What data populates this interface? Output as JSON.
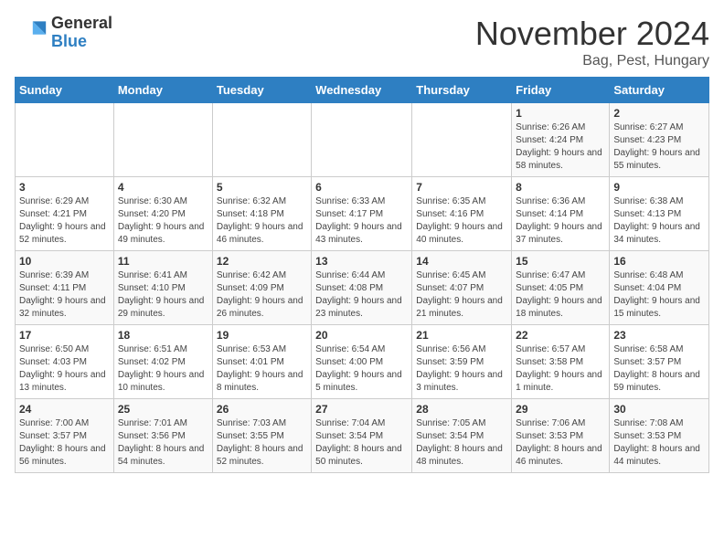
{
  "logo": {
    "general": "General",
    "blue": "Blue"
  },
  "title": "November 2024",
  "subtitle": "Bag, Pest, Hungary",
  "days_header": [
    "Sunday",
    "Monday",
    "Tuesday",
    "Wednesday",
    "Thursday",
    "Friday",
    "Saturday"
  ],
  "weeks": [
    [
      {
        "day": "",
        "info": ""
      },
      {
        "day": "",
        "info": ""
      },
      {
        "day": "",
        "info": ""
      },
      {
        "day": "",
        "info": ""
      },
      {
        "day": "",
        "info": ""
      },
      {
        "day": "1",
        "info": "Sunrise: 6:26 AM\nSunset: 4:24 PM\nDaylight: 9 hours and 58 minutes."
      },
      {
        "day": "2",
        "info": "Sunrise: 6:27 AM\nSunset: 4:23 PM\nDaylight: 9 hours and 55 minutes."
      }
    ],
    [
      {
        "day": "3",
        "info": "Sunrise: 6:29 AM\nSunset: 4:21 PM\nDaylight: 9 hours and 52 minutes."
      },
      {
        "day": "4",
        "info": "Sunrise: 6:30 AM\nSunset: 4:20 PM\nDaylight: 9 hours and 49 minutes."
      },
      {
        "day": "5",
        "info": "Sunrise: 6:32 AM\nSunset: 4:18 PM\nDaylight: 9 hours and 46 minutes."
      },
      {
        "day": "6",
        "info": "Sunrise: 6:33 AM\nSunset: 4:17 PM\nDaylight: 9 hours and 43 minutes."
      },
      {
        "day": "7",
        "info": "Sunrise: 6:35 AM\nSunset: 4:16 PM\nDaylight: 9 hours and 40 minutes."
      },
      {
        "day": "8",
        "info": "Sunrise: 6:36 AM\nSunset: 4:14 PM\nDaylight: 9 hours and 37 minutes."
      },
      {
        "day": "9",
        "info": "Sunrise: 6:38 AM\nSunset: 4:13 PM\nDaylight: 9 hours and 34 minutes."
      }
    ],
    [
      {
        "day": "10",
        "info": "Sunrise: 6:39 AM\nSunset: 4:11 PM\nDaylight: 9 hours and 32 minutes."
      },
      {
        "day": "11",
        "info": "Sunrise: 6:41 AM\nSunset: 4:10 PM\nDaylight: 9 hours and 29 minutes."
      },
      {
        "day": "12",
        "info": "Sunrise: 6:42 AM\nSunset: 4:09 PM\nDaylight: 9 hours and 26 minutes."
      },
      {
        "day": "13",
        "info": "Sunrise: 6:44 AM\nSunset: 4:08 PM\nDaylight: 9 hours and 23 minutes."
      },
      {
        "day": "14",
        "info": "Sunrise: 6:45 AM\nSunset: 4:07 PM\nDaylight: 9 hours and 21 minutes."
      },
      {
        "day": "15",
        "info": "Sunrise: 6:47 AM\nSunset: 4:05 PM\nDaylight: 9 hours and 18 minutes."
      },
      {
        "day": "16",
        "info": "Sunrise: 6:48 AM\nSunset: 4:04 PM\nDaylight: 9 hours and 15 minutes."
      }
    ],
    [
      {
        "day": "17",
        "info": "Sunrise: 6:50 AM\nSunset: 4:03 PM\nDaylight: 9 hours and 13 minutes."
      },
      {
        "day": "18",
        "info": "Sunrise: 6:51 AM\nSunset: 4:02 PM\nDaylight: 9 hours and 10 minutes."
      },
      {
        "day": "19",
        "info": "Sunrise: 6:53 AM\nSunset: 4:01 PM\nDaylight: 9 hours and 8 minutes."
      },
      {
        "day": "20",
        "info": "Sunrise: 6:54 AM\nSunset: 4:00 PM\nDaylight: 9 hours and 5 minutes."
      },
      {
        "day": "21",
        "info": "Sunrise: 6:56 AM\nSunset: 3:59 PM\nDaylight: 9 hours and 3 minutes."
      },
      {
        "day": "22",
        "info": "Sunrise: 6:57 AM\nSunset: 3:58 PM\nDaylight: 9 hours and 1 minute."
      },
      {
        "day": "23",
        "info": "Sunrise: 6:58 AM\nSunset: 3:57 PM\nDaylight: 8 hours and 59 minutes."
      }
    ],
    [
      {
        "day": "24",
        "info": "Sunrise: 7:00 AM\nSunset: 3:57 PM\nDaylight: 8 hours and 56 minutes."
      },
      {
        "day": "25",
        "info": "Sunrise: 7:01 AM\nSunset: 3:56 PM\nDaylight: 8 hours and 54 minutes."
      },
      {
        "day": "26",
        "info": "Sunrise: 7:03 AM\nSunset: 3:55 PM\nDaylight: 8 hours and 52 minutes."
      },
      {
        "day": "27",
        "info": "Sunrise: 7:04 AM\nSunset: 3:54 PM\nDaylight: 8 hours and 50 minutes."
      },
      {
        "day": "28",
        "info": "Sunrise: 7:05 AM\nSunset: 3:54 PM\nDaylight: 8 hours and 48 minutes."
      },
      {
        "day": "29",
        "info": "Sunrise: 7:06 AM\nSunset: 3:53 PM\nDaylight: 8 hours and 46 minutes."
      },
      {
        "day": "30",
        "info": "Sunrise: 7:08 AM\nSunset: 3:53 PM\nDaylight: 8 hours and 44 minutes."
      }
    ]
  ]
}
